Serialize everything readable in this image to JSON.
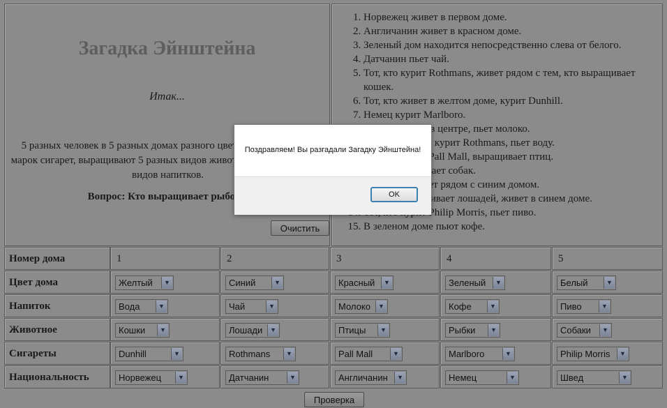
{
  "intro": {
    "title": "Загадка Эйнштейна",
    "itak": "Итак...",
    "description": "5 разных человек в 5 разных домах разного цвета, курят 5 разных марок сигарет, выращивают 5 разных видов животных, пьют 5 разных видов напитков.",
    "question": "Вопрос: Кто выращивает рыбок?",
    "clear_button": "Очистить"
  },
  "rules": [
    "Норвежец живет в первом доме.",
    "Англичанин живет в красном доме.",
    "Зеленый дом находится непосредственно слева от белого.",
    "Датчанин пьет чай.",
    "Тот, кто курит Rothmans, живет рядом с тем, кто выращивает кошек.",
    "Тот, кто живет в желтом доме, курит Dunhill.",
    "Немец курит Marlboro.",
    "Тот, кто живет в центре, пьет молоко.",
    "Сосед того, кто курит Rothmans, пьет воду.",
    "Тот, кто курит Pall Mall, выращивает птиц.",
    "Швед выращивает собак.",
    "Норвежец живет рядом с синим домом.",
    "Тот, кто выращивает лошадей, живет в синем доме.",
    "Тот, кто курит Philip Morris, пьет пиво.",
    "В зеленом доме пьют кофе."
  ],
  "grid": {
    "row_labels": [
      "Номер дома",
      "Цвет дома",
      "Напиток",
      "Животное",
      "Сигареты",
      "Национальность"
    ],
    "house_numbers": [
      "1",
      "2",
      "3",
      "4",
      "5"
    ],
    "colors": [
      "Желтый",
      "Синий",
      "Красный",
      "Зеленый",
      "Белый"
    ],
    "drinks": [
      "Вода",
      "Чай",
      "Молоко",
      "Кофе",
      "Пиво"
    ],
    "animals": [
      "Кошки",
      "Лошади",
      "Птицы",
      "Рыбки",
      "Собаки"
    ],
    "cigarettes": [
      "Dunhill",
      "Rothmans",
      "Pall Mall",
      "Marlboro",
      "Philip Morris"
    ],
    "nationalities": [
      "Норвежец",
      "Датчанин",
      "Англичанин",
      "Немец",
      "Швед"
    ]
  },
  "check_button": "Проверка",
  "dialog": {
    "message": "Поздравляем! Вы разгадали Загадку Эйнштейна!",
    "ok": "OK"
  },
  "icons": {
    "dropdown_arrow": "chevron-down-icon"
  }
}
